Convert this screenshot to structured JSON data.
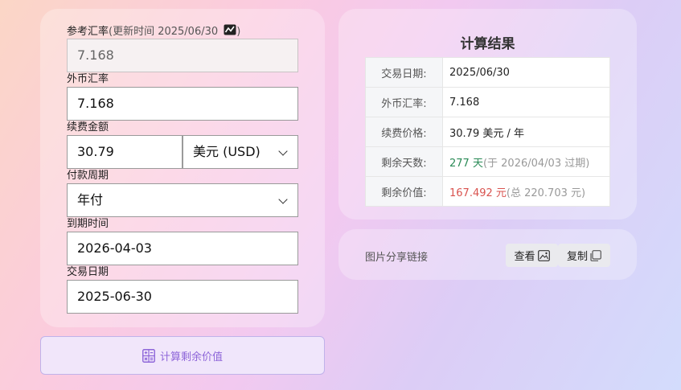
{
  "form": {
    "ref_rate_label": "参考汇率",
    "ref_rate_sub_prefix": "(更新时间 2025/06/30",
    "ref_rate_sub_suffix": ")",
    "ref_rate_value": "7.168",
    "fx_rate_label": "外币汇率",
    "fx_rate_value": "7.168",
    "amount_label": "续费金额",
    "amount_value": "30.79",
    "currency_value": "美元 (USD)",
    "period_label": "付款周期",
    "period_value": "年付",
    "expiry_label": "到期时间",
    "expiry_value": "2026-04-03",
    "trade_date_label": "交易日期",
    "trade_date_value": "2025-06-30"
  },
  "calc_button": {
    "label": "计算剩余价值"
  },
  "result": {
    "title": "计算结果",
    "rows": [
      {
        "key": "交易日期:",
        "value": "2025/06/30"
      },
      {
        "key": "外币汇率:",
        "value": "7.168"
      },
      {
        "key": "续费价格:",
        "value": "30.79 美元 / 年"
      },
      {
        "key": "剩余天数:",
        "value": "277 天",
        "note": "(于 2026/04/03 过期)"
      },
      {
        "key": "剩余价值:",
        "value": "167.492 元",
        "note": "(总 220.703 元)"
      }
    ]
  },
  "share": {
    "label": "图片分享链接",
    "view_label": "查看",
    "copy_label": "复制"
  },
  "colors": {
    "accent": "#8e66d9",
    "green": "#2a8a56",
    "red": "#d9534f"
  }
}
